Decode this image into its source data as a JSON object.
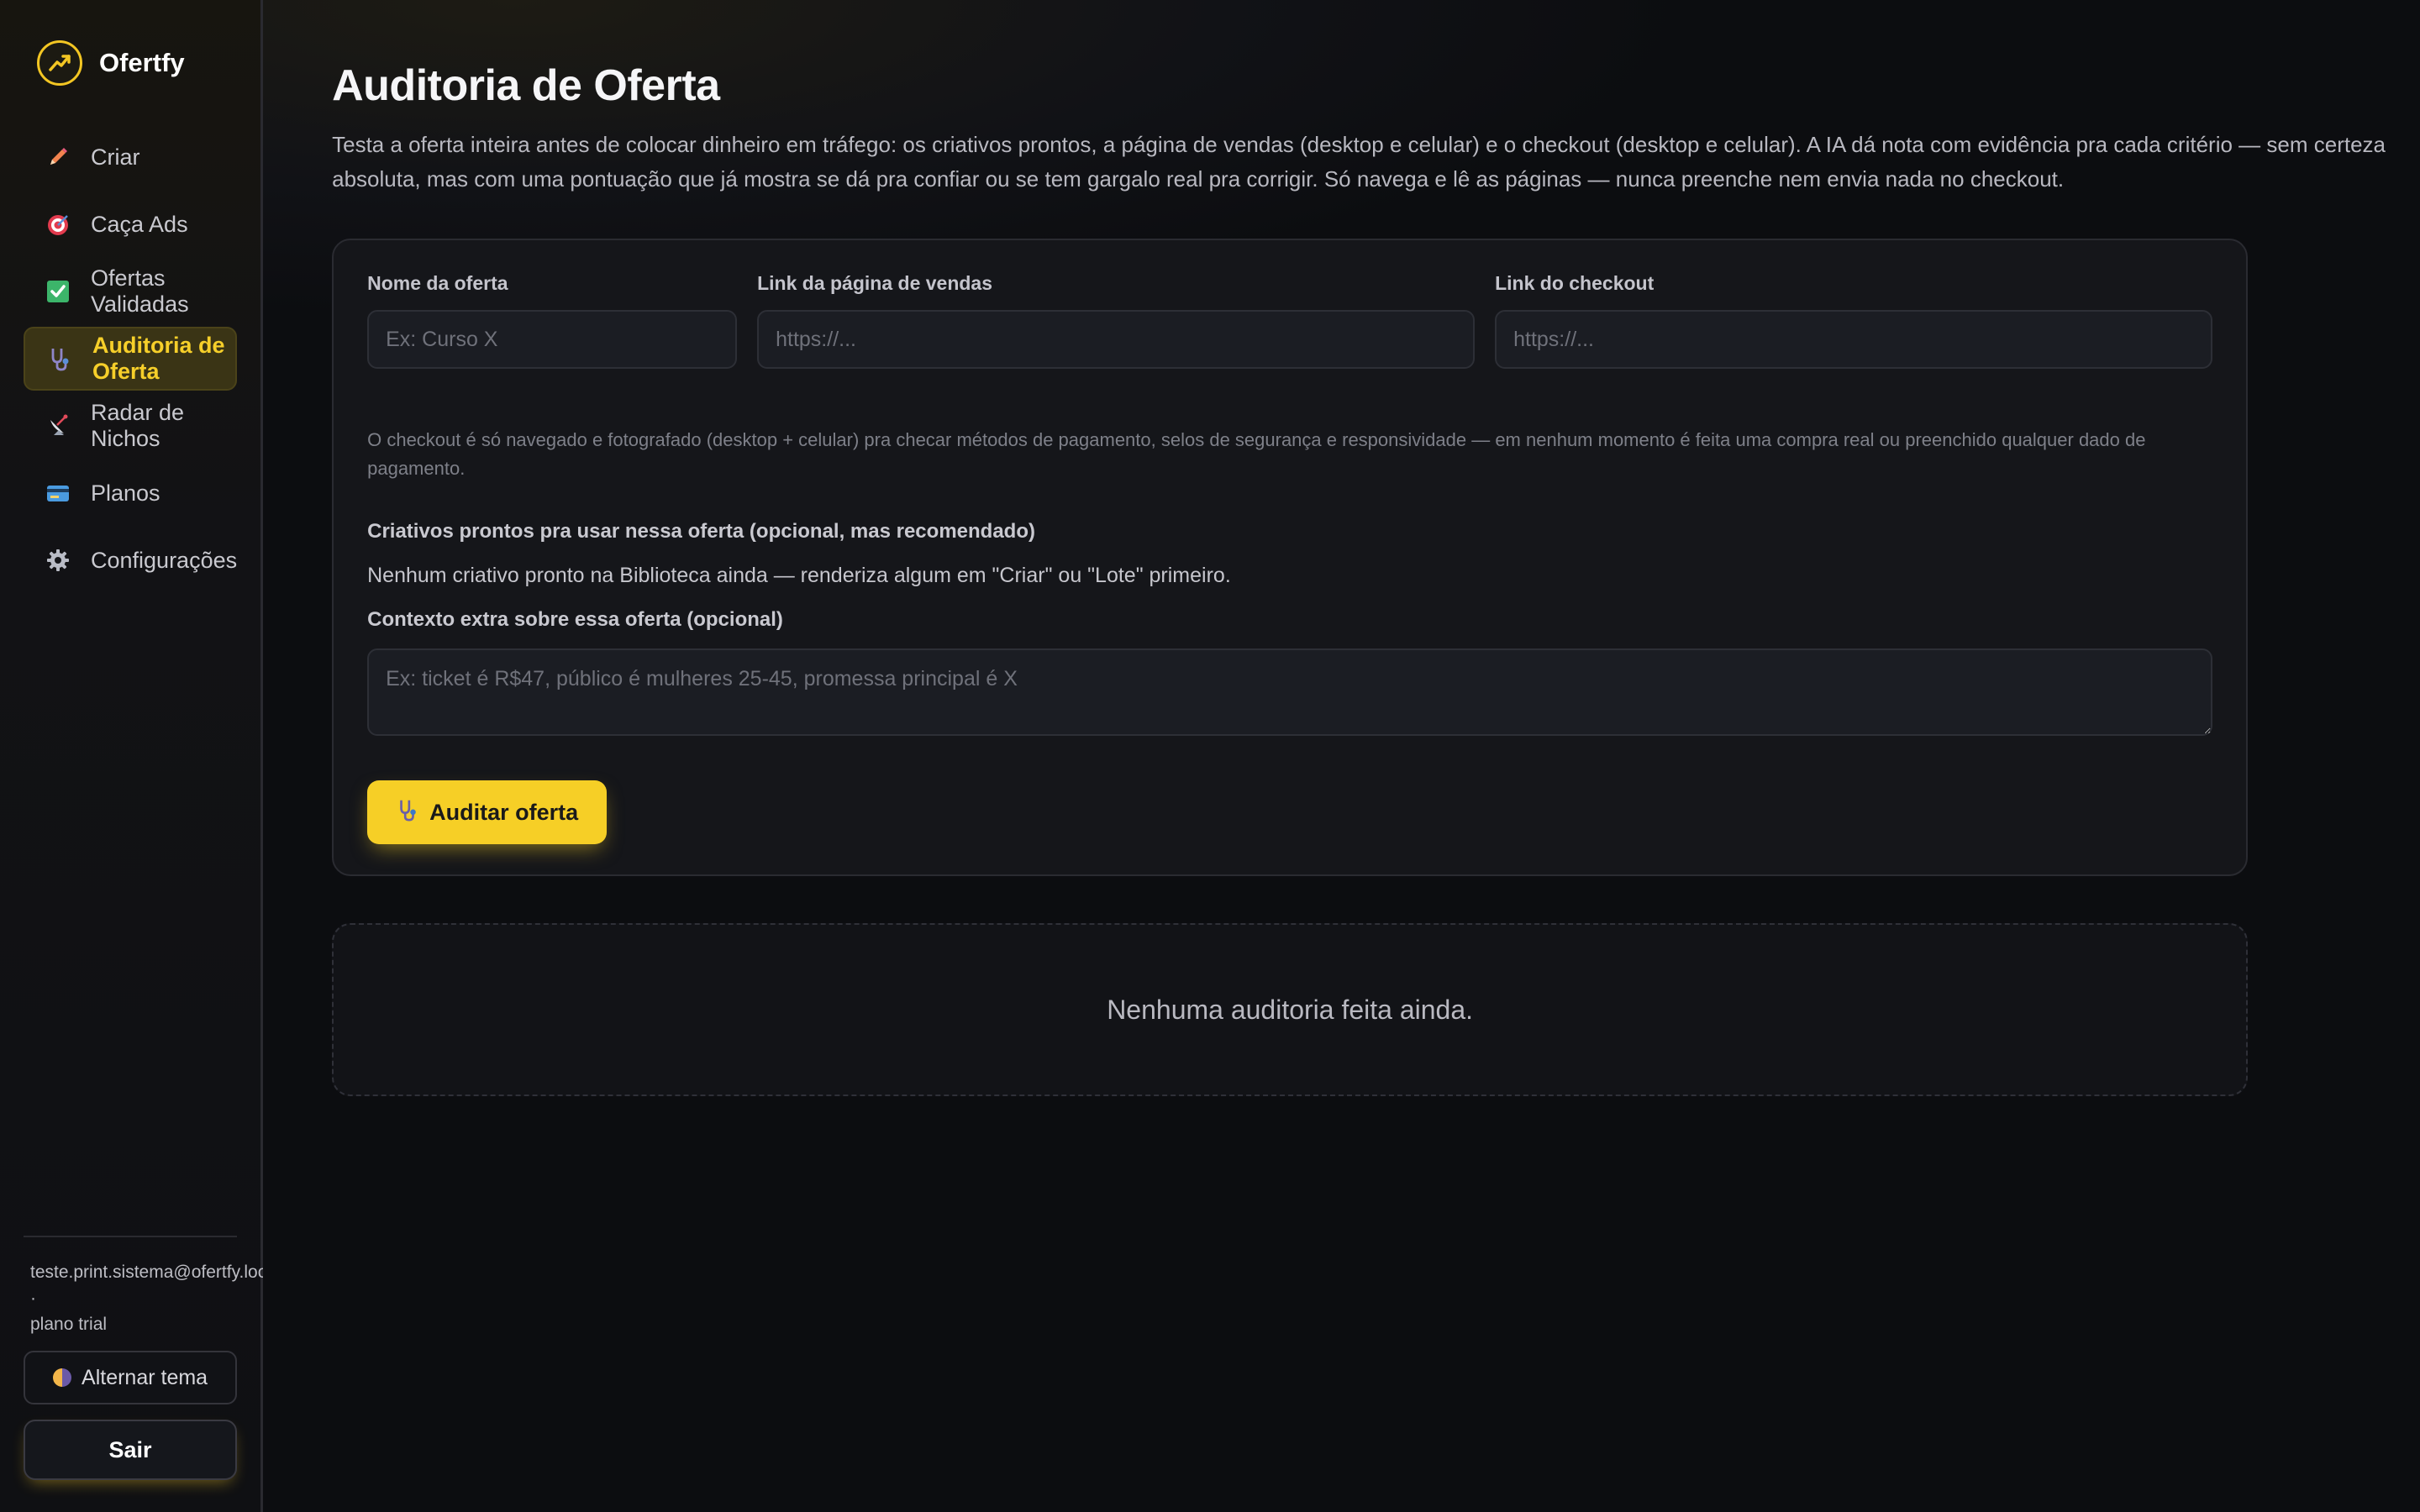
{
  "app": {
    "name": "Ofertfy"
  },
  "sidebar": {
    "items": [
      {
        "label": "Criar",
        "icon": "pencil-icon",
        "active": false
      },
      {
        "label": "Caça Ads",
        "icon": "target-icon",
        "active": false
      },
      {
        "label": "Ofertas Validadas",
        "icon": "checkbox-icon",
        "active": false
      },
      {
        "label": "Auditoria de Oferta",
        "icon": "stethoscope-icon",
        "active": true
      },
      {
        "label": "Radar de Nichos",
        "icon": "satellite-icon",
        "active": false
      },
      {
        "label": "Planos",
        "icon": "credit-card-icon",
        "active": false
      },
      {
        "label": "Configurações",
        "icon": "gear-icon",
        "active": false
      }
    ],
    "user_email": "teste.print.sistema@ofertfy.local ·",
    "user_plan": "plano trial",
    "theme_button": "Alternar tema",
    "logout_button": "Sair"
  },
  "main": {
    "title": "Auditoria de Oferta",
    "description": "Testa a oferta inteira antes de colocar dinheiro em tráfego: os criativos prontos, a página de vendas (desktop e celular) e o checkout (desktop e celular). A IA dá nota com evidência pra cada critério — sem certeza absoluta, mas com uma pontuação que já mostra se dá pra confiar ou se tem gargalo real pra corrigir. Só navega e lê as páginas — nunca preenche nem envia nada no checkout.",
    "form": {
      "offer_name_label": "Nome da oferta",
      "offer_name_placeholder": "Ex: Curso X",
      "sales_page_label": "Link da página de vendas",
      "sales_page_placeholder": "https://...",
      "checkout_label": "Link do checkout",
      "checkout_placeholder": "https://...",
      "checkout_note": "O checkout é só navegado e fotografado (desktop + celular) pra checar métodos de pagamento, selos de segurança e responsividade — em nenhum momento é feita uma compra real ou preenchido qualquer dado de pagamento.",
      "creatives_label": "Criativos prontos pra usar nessa oferta (opcional, mas recomendado)",
      "creatives_empty": "Nenhum criativo pronto na Biblioteca ainda — renderiza algum em \"Criar\" ou \"Lote\" primeiro.",
      "context_label": "Contexto extra sobre essa oferta (opcional)",
      "context_placeholder": "Ex: ticket é R$47, público é mulheres 25-45, promessa principal é X",
      "submit_button": "Auditar oferta"
    },
    "empty_state": "Nenhuma auditoria feita ainda."
  },
  "colors": {
    "accent": "#f6cf26",
    "active_bg": "#3a3415",
    "background": "#0c0d10"
  }
}
